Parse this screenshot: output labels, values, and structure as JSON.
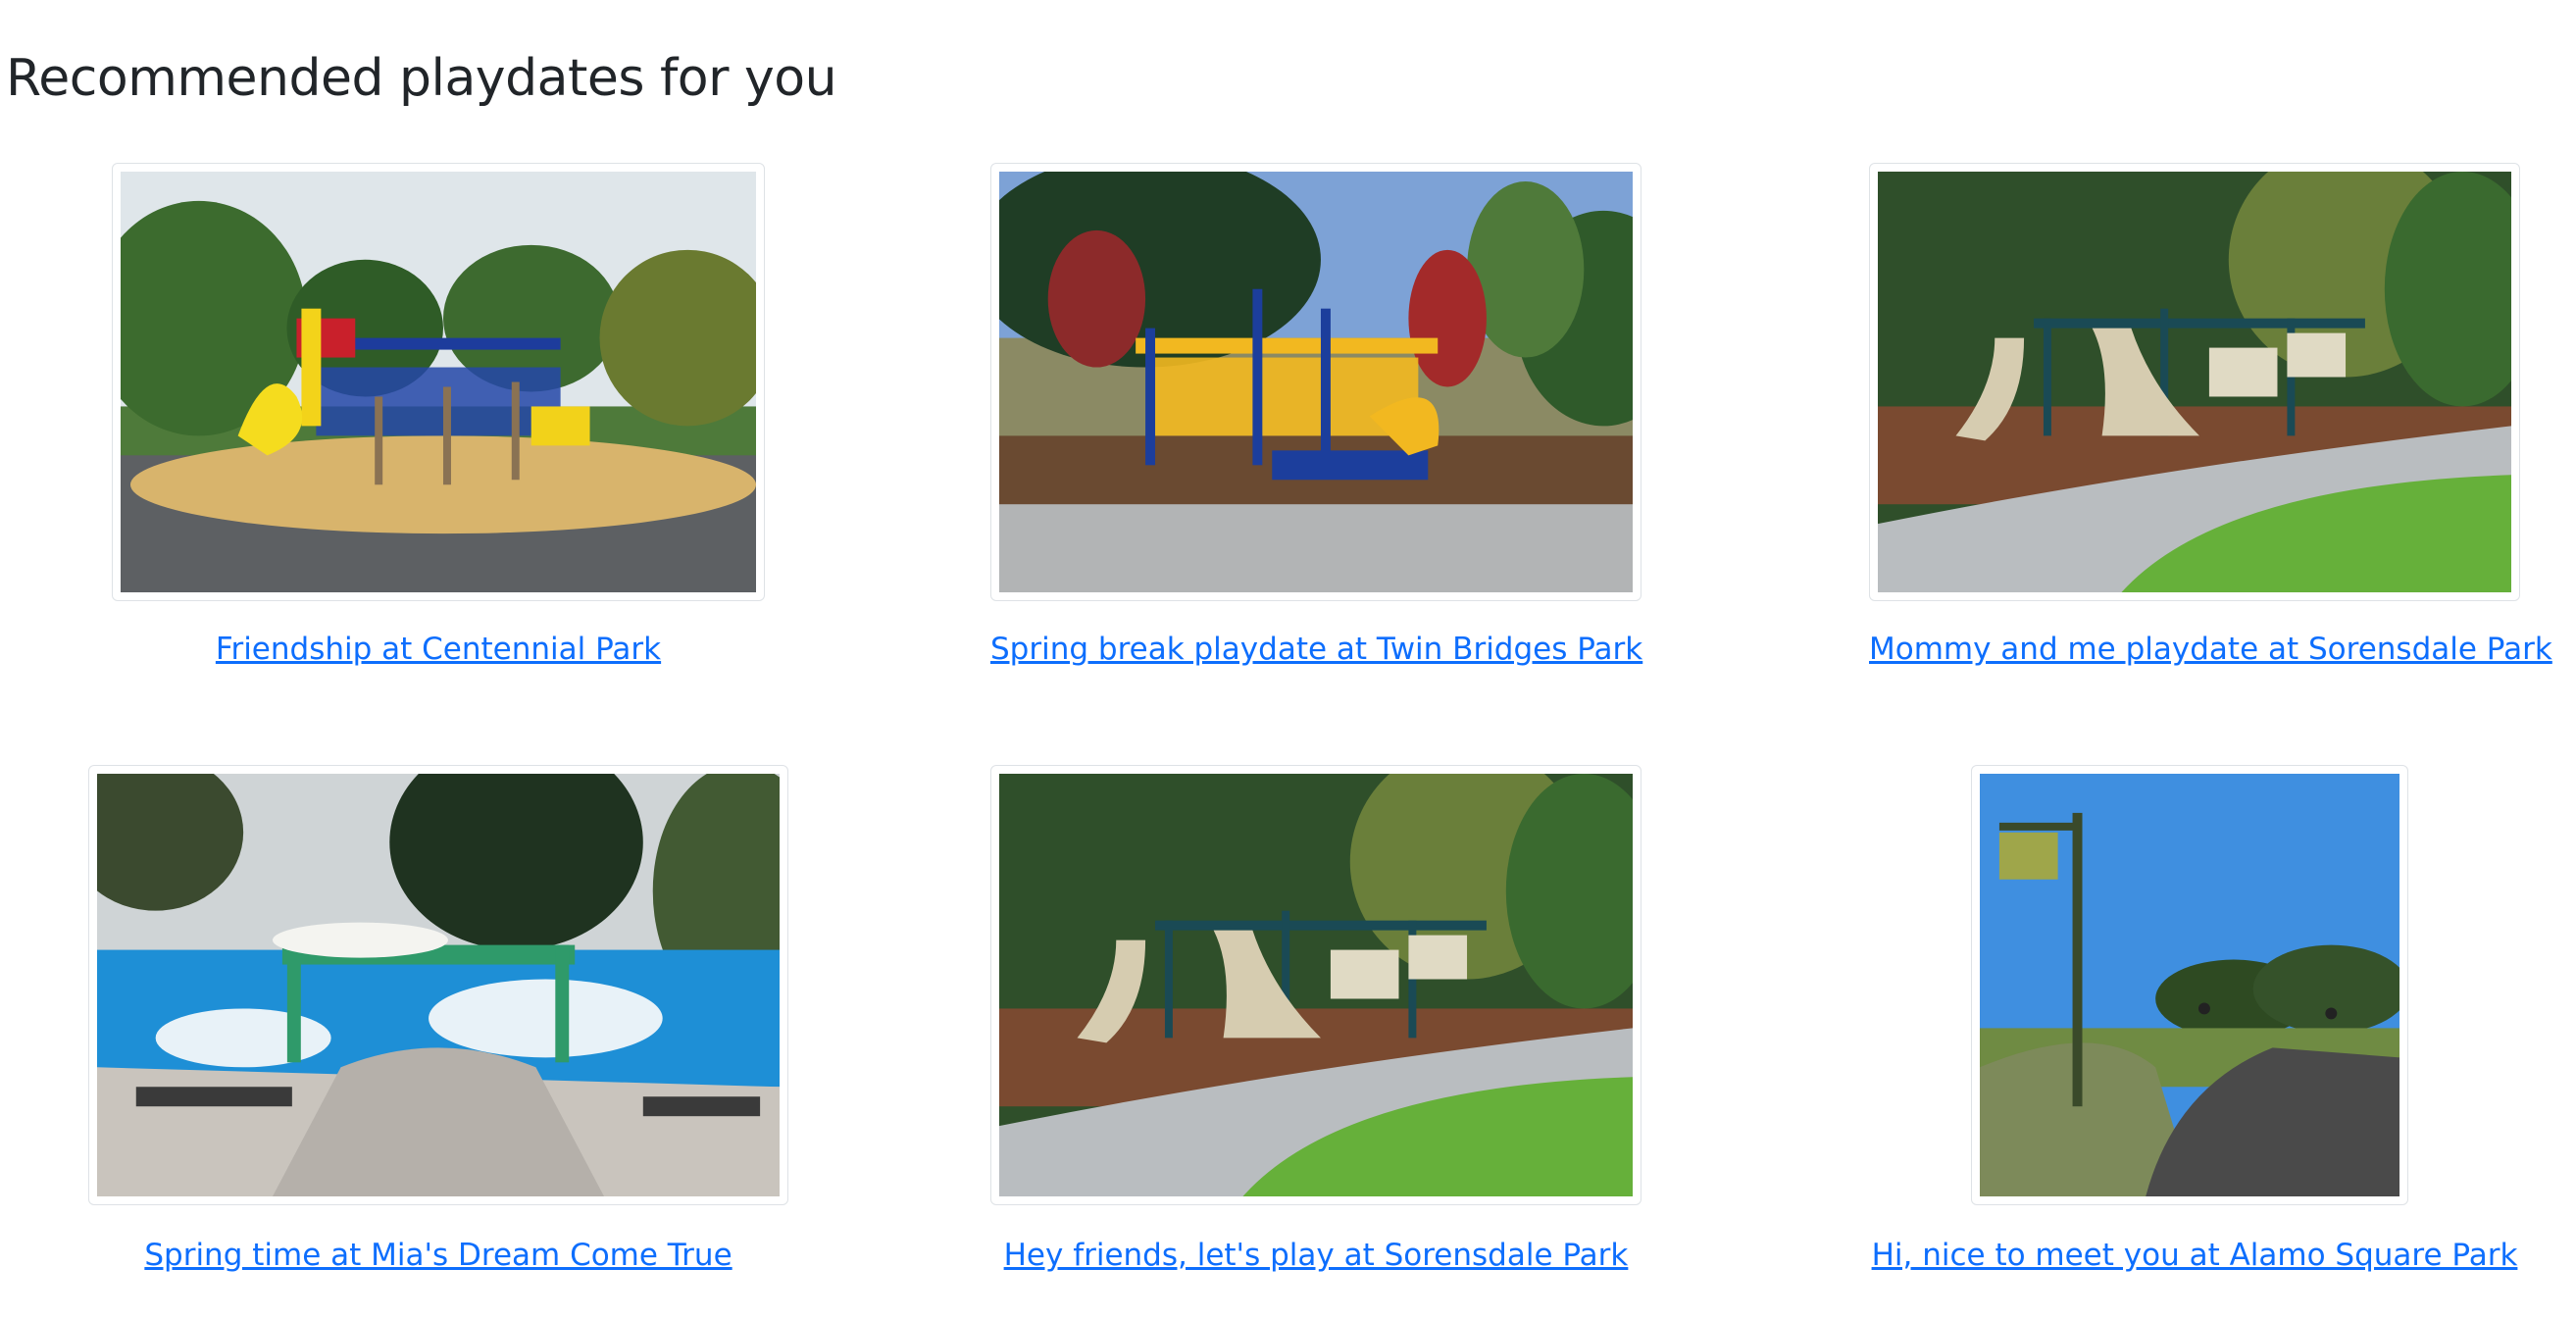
{
  "page": {
    "title": "Recommended playdates for you"
  },
  "playdates": [
    {
      "title": "Friendship at Centennial Park",
      "image": "playground-yellow-slide-image"
    },
    {
      "title": "Spring break playdate at Twin Bridges Park",
      "image": "playground-blue-yellow-image"
    },
    {
      "title": "Mommy and me playdate at Sorensdale Park",
      "image": "playground-tan-slides-image"
    },
    {
      "title": "Spring time at Mia's Dream Come True",
      "image": "playground-splash-pad-image"
    },
    {
      "title": "Hey friends, let's play at Sorensdale Park",
      "image": "playground-tan-slides-image"
    },
    {
      "title": "Hi, nice to meet you at Alamo Square Park",
      "image": "park-signpost-image"
    }
  ],
  "colors": {
    "link": "#0d6efd",
    "heading": "#212529",
    "card_border": "#dee2e6"
  }
}
